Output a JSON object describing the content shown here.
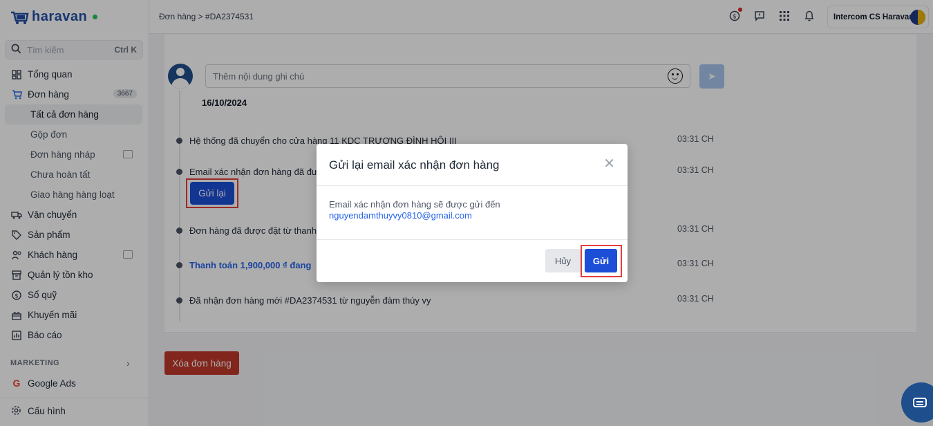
{
  "app": {
    "logo_text": "haravan",
    "colors": {
      "brand": "#2250a6",
      "primary": "#1d4ed8",
      "danger": "#c0392b",
      "highlight": "#e53e3e"
    }
  },
  "search": {
    "placeholder": "Tìm kiếm",
    "shortcut": "Ctrl K"
  },
  "sidebar": {
    "overview": "Tổng quan",
    "orders": {
      "label": "Đơn hàng",
      "badge": "3667"
    },
    "order_subs": [
      "Tất cả đơn hàng",
      "Gộp đơn",
      "Đơn hàng nháp",
      "Chưa hoàn tất",
      "Giao hàng hàng loạt"
    ],
    "shipping": "Vận chuyển",
    "products": "Sản phẩm",
    "customers": "Khách hàng",
    "inventory": "Quản lý tồn kho",
    "cashbook": "Sổ quỹ",
    "promotions": "Khuyến mãi",
    "reports": "Báo cáo",
    "marketing_label": "MARKETING",
    "google_ads": "Google Ads",
    "settings": "Cấu hình"
  },
  "header": {
    "breadcrumb": "Đơn hàng > #DA2374531",
    "account_name": "Intercom CS Haravan"
  },
  "timeline": {
    "note_placeholder": "Thêm nội dung ghi chú",
    "date": "16/10/2024",
    "events": [
      {
        "text": "Hệ thống đã chuyển cho cửa hàng 11 KDC TRƯƠNG ĐÌNH HỘI III",
        "time": "03:31 CH"
      },
      {
        "text": "Email xác nhận đơn hàng đã đư",
        "time": "03:31 CH"
      },
      {
        "text": "Đơn hàng đã được đặt từ thanh",
        "time": "03:31 CH"
      },
      {
        "text": "Thanh toán 1,900,000 ₫ đang",
        "time": "03:31 CH"
      },
      {
        "text": "Đã nhận đơn hàng mới #DA2374531 từ nguyễn đàm thúy vy",
        "time": "03:31 CH"
      }
    ],
    "resend_label": "Gửi lại"
  },
  "delete_order_label": "Xóa đơn hàng",
  "modal": {
    "title": "Gửi lại email xác nhận đơn hàng",
    "message": "Email xác nhận đơn hàng sẽ được gửi đến",
    "email": "nguyendamthuyvy0810@gmail.com",
    "cancel_label": "Hủy",
    "send_label": "Gửi"
  }
}
